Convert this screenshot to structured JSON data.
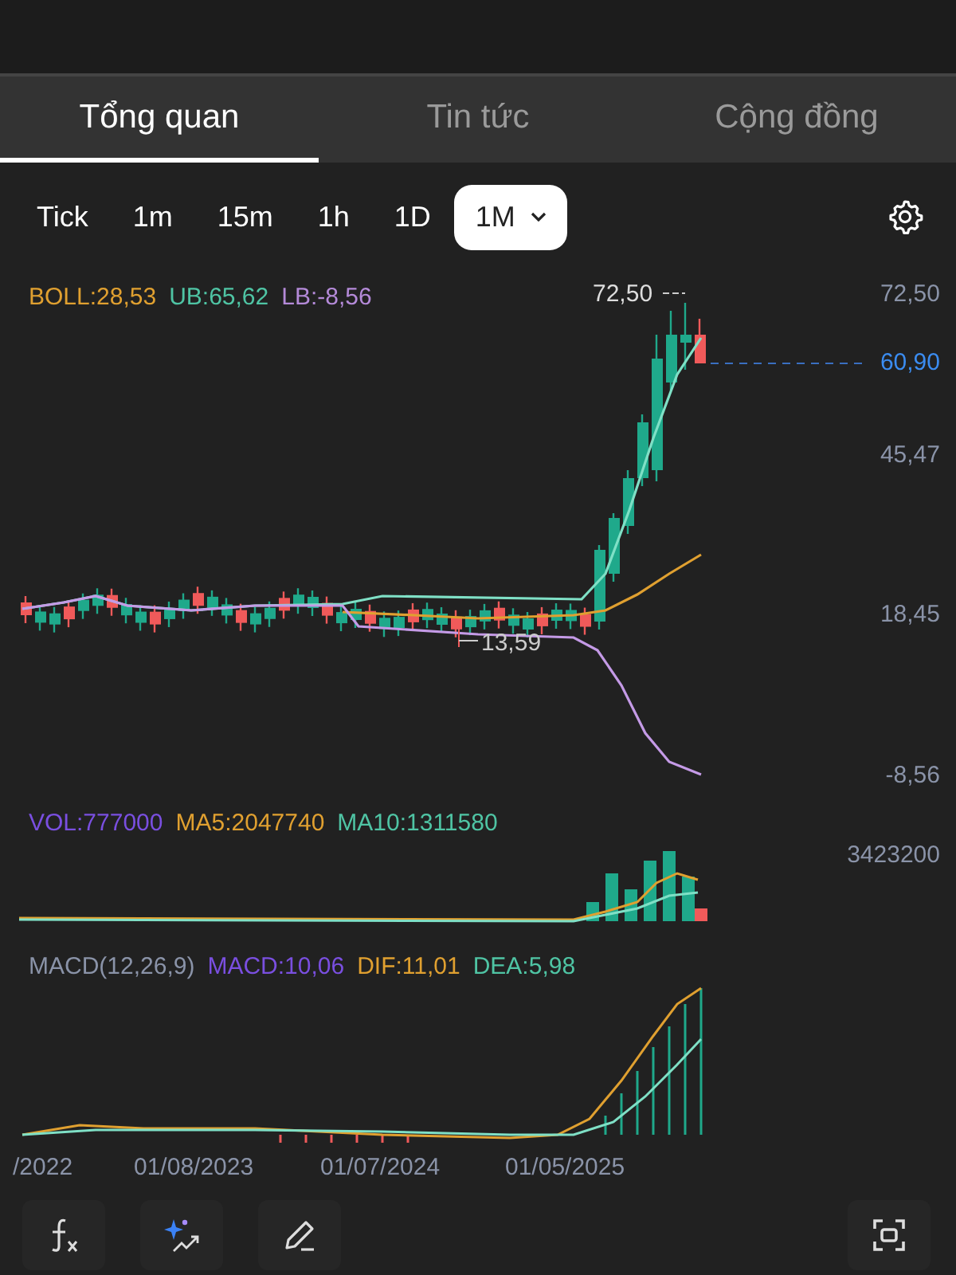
{
  "tabs": [
    {
      "label": "Tổng quan",
      "selected": true
    },
    {
      "label": "Tin tức",
      "selected": false
    },
    {
      "label": "Cộng đồng",
      "selected": false
    }
  ],
  "intervals": [
    {
      "label": "Tick",
      "selected": false,
      "dropdown": false
    },
    {
      "label": "1m",
      "selected": false,
      "dropdown": false
    },
    {
      "label": "15m",
      "selected": false,
      "dropdown": false
    },
    {
      "label": "1h",
      "selected": false,
      "dropdown": false
    },
    {
      "label": "1D",
      "selected": false,
      "dropdown": false
    },
    {
      "label": "1M",
      "selected": true,
      "dropdown": true
    }
  ],
  "price_panel": {
    "legend": [
      {
        "text": "BOLL:28,53",
        "color": "#e0a030"
      },
      {
        "text": "UB:65,62",
        "color": "#4fc4a4"
      },
      {
        "text": "LB:-8,56",
        "color": "#b48ad8"
      }
    ],
    "y_labels": [
      "72,50",
      "45,47",
      "18,45",
      "-8,56"
    ],
    "last_price": "60,90",
    "high_marker": "72,50",
    "low_marker": "13,59"
  },
  "volume_panel": {
    "legend": [
      {
        "text": "VOL:777000",
        "color": "#7a4fe0"
      },
      {
        "text": "MA5:2047740",
        "color": "#e0a030"
      },
      {
        "text": "MA10:1311580",
        "color": "#4fc4a4"
      }
    ],
    "y_label": "3423200"
  },
  "macd_panel": {
    "legend": [
      {
        "text": "MACD(12,26,9)",
        "color": "#8a93a8"
      },
      {
        "text": "MACD:10,06",
        "color": "#7a4fe0"
      },
      {
        "text": "DIF:11,01",
        "color": "#e0a030"
      },
      {
        "text": "DEA:5,98",
        "color": "#4fc4a4"
      }
    ]
  },
  "x_labels": [
    "/2022",
    "01/08/2023",
    "01/07/2024",
    "01/05/2025"
  ]
}
